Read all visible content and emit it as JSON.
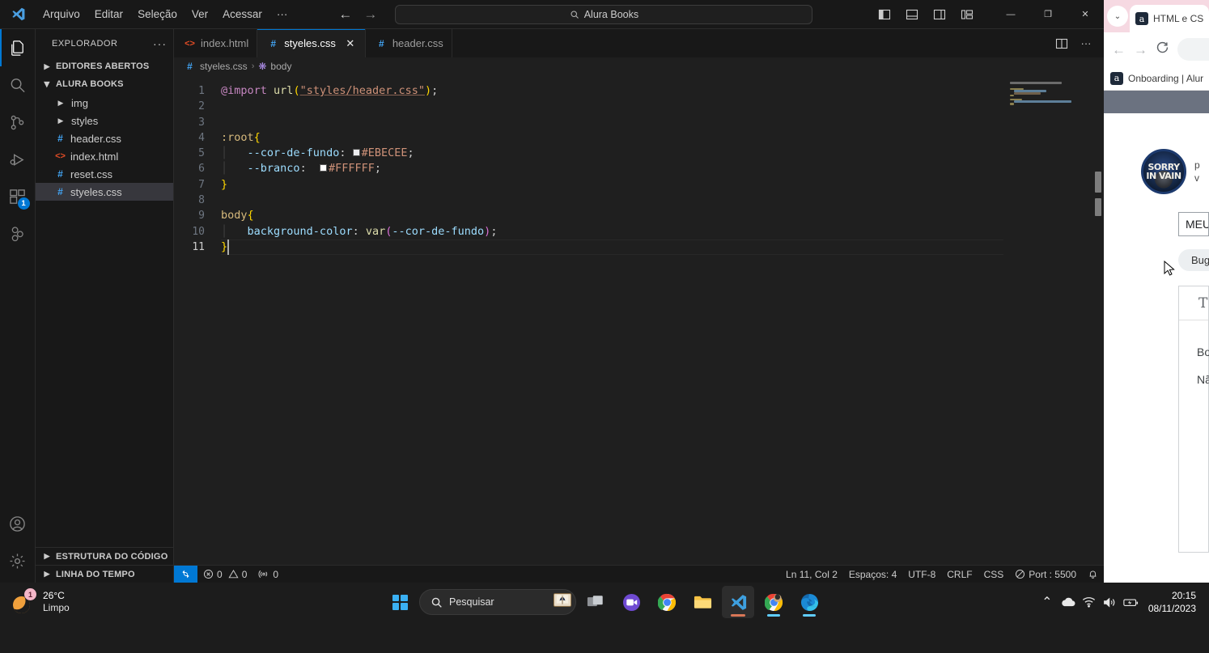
{
  "vscode": {
    "menu": [
      "Arquivo",
      "Editar",
      "Seleção",
      "Ver",
      "Acessar",
      "···"
    ],
    "quickopen": {
      "text": "Alura Books",
      "icon": "search-icon"
    },
    "window_controls": {
      "minimize": "—",
      "maximize": "❐",
      "close": "✕"
    },
    "activitybar": [
      {
        "name": "explorer",
        "icon": "files-icon",
        "active": true,
        "badge": ""
      },
      {
        "name": "search",
        "icon": "search-icon",
        "active": false,
        "badge": ""
      },
      {
        "name": "source-control",
        "icon": "source-control-icon",
        "active": false,
        "badge": ""
      },
      {
        "name": "run-debug",
        "icon": "run-debug-icon",
        "active": false,
        "badge": ""
      },
      {
        "name": "extensions",
        "icon": "extensions-icon",
        "active": false,
        "badge": "1"
      },
      {
        "name": "figma",
        "icon": "figma-icon",
        "active": false,
        "badge": ""
      }
    ],
    "activitybar_bottom": [
      {
        "name": "accounts",
        "icon": "account-icon"
      },
      {
        "name": "settings",
        "icon": "gear-icon"
      }
    ],
    "sidebar": {
      "title": "EXPLORADOR",
      "more_label": "···",
      "sections": [
        {
          "label": "EDITORES ABERTOS",
          "expanded": false
        },
        {
          "label": "ALURA BOOKS",
          "expanded": true
        }
      ],
      "tree": [
        {
          "label": "img",
          "type": "folder",
          "icon": "chevron-right-icon",
          "selected": false
        },
        {
          "label": "styles",
          "type": "folder",
          "icon": "chevron-right-icon",
          "selected": false
        },
        {
          "label": "header.css",
          "type": "css",
          "icon": "css-file-icon",
          "selected": false
        },
        {
          "label": "index.html",
          "type": "html",
          "icon": "html-file-icon",
          "selected": false
        },
        {
          "label": "reset.css",
          "type": "css",
          "icon": "css-file-icon",
          "selected": false
        },
        {
          "label": "styeles.css",
          "type": "css",
          "icon": "css-file-icon",
          "selected": true
        }
      ],
      "footer_sections": [
        {
          "label": "ESTRUTURA DO CÓDIGO",
          "expanded": false
        },
        {
          "label": "LINHA DO TEMPO",
          "expanded": false
        }
      ]
    },
    "tabs": [
      {
        "label": "index.html",
        "type": "html",
        "active": false,
        "closable": false
      },
      {
        "label": "styeles.css",
        "type": "css",
        "active": true,
        "closable": true,
        "close_label": "✕"
      },
      {
        "label": "header.css",
        "type": "css",
        "active": false,
        "closable": false
      }
    ],
    "breadcrumb": {
      "file": "styeles.css",
      "separator": "›",
      "symbol": "body",
      "file_icon": "css-file-icon",
      "symbol_icon": "css-symbol-icon"
    },
    "code": {
      "language": "CSS",
      "lines": [
        {
          "n": "1",
          "text": "@import url(\"styles/header.css\");"
        },
        {
          "n": "2",
          "text": ""
        },
        {
          "n": "3",
          "text": ""
        },
        {
          "n": "4",
          "text": ":root{"
        },
        {
          "n": "5",
          "text": "    --cor-de-fundo: #EBECEE;"
        },
        {
          "n": "6",
          "text": "    --branco:  #FFFFFF;"
        },
        {
          "n": "7",
          "text": "}"
        },
        {
          "n": "8",
          "text": ""
        },
        {
          "n": "9",
          "text": "body{"
        },
        {
          "n": "10",
          "text": "    background-color: var(--cor-de-fundo);"
        },
        {
          "n": "11",
          "text": "}"
        }
      ],
      "swatches": {
        "cor_de_fundo": "#EBECEE",
        "branco": "#FFFFFF"
      },
      "current_line": "11"
    },
    "statusbar": {
      "remote_icon": "remote-window-icon",
      "errors": "0",
      "warnings": "0",
      "ports": "0",
      "position": "Ln 11, Col 2",
      "spaces": "Espaços: 4",
      "encoding": "UTF-8",
      "eol": "CRLF",
      "language": "CSS",
      "live_server": "Port : 5500",
      "bell_icon": "bell-icon"
    }
  },
  "chrome": {
    "tab": {
      "title": "HTML e CS",
      "favicon": "alura-icon"
    },
    "chevron_label": "⌄",
    "nav": {
      "back": "←",
      "forward": "→",
      "reload": "reload-icon"
    },
    "bookmark": {
      "label": "Onboarding | Alur",
      "favicon": "alura-icon"
    },
    "post": {
      "avatar_line1": "SORRY",
      "avatar_line2": "IN VAIN",
      "author_line1": "p",
      "author_line2": "v",
      "title_value": "MEU HAM",
      "tags": [
        "Bug"
      ],
      "editor_toolbar": [
        "T"
      ],
      "body_lines": [
        "Boa no",
        "Não es"
      ]
    }
  },
  "taskbar": {
    "weather": {
      "temp": "26°C",
      "condition": "Limpo",
      "badge": "1",
      "icon": "moon-icon"
    },
    "start_label": "start-icon",
    "search": {
      "placeholder": "Pesquisar",
      "icon": "search-icon",
      "widget_icon": "book-icon"
    },
    "apps": [
      {
        "name": "task-view",
        "icon": "task-view-icon",
        "active": false,
        "running": false
      },
      {
        "name": "meet",
        "icon": "video-call-icon",
        "active": false,
        "running": false
      },
      {
        "name": "chrome",
        "icon": "chrome-icon",
        "active": false,
        "running": false
      },
      {
        "name": "file-explorer",
        "icon": "folder-icon",
        "active": false,
        "running": false
      },
      {
        "name": "vscode",
        "icon": "vscode-icon",
        "active": true,
        "running": true
      },
      {
        "name": "chrome-profile",
        "icon": "chrome-profile-icon",
        "active": false,
        "running": true
      },
      {
        "name": "edge",
        "icon": "edge-icon",
        "active": false,
        "running": true
      }
    ],
    "tray": {
      "chevron": "⌃",
      "onedrive_icon": "cloud-icon",
      "wifi_icon": "wifi-icon",
      "volume_icon": "speaker-icon",
      "battery_icon": "battery-icon",
      "time": "20:15",
      "date": "08/11/2023"
    }
  }
}
